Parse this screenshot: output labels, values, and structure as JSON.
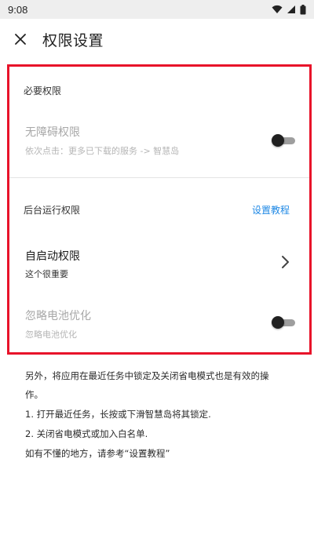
{
  "status_bar": {
    "time": "9:08",
    "icons": [
      "wifi-icon",
      "signal-icon",
      "battery-icon"
    ]
  },
  "app_bar": {
    "close_icon": "close-icon",
    "title": "权限设置"
  },
  "permissions": {
    "required": {
      "section_label": "必要权限",
      "accessibility": {
        "title": "无障碍权限",
        "subtitle": "依次点击：更多已下载的服务 -> 智慧岛",
        "enabled": false
      }
    },
    "background": {
      "section_label": "后台运行权限",
      "tutorial_link": "设置教程",
      "autostart": {
        "title": "自启动权限",
        "subtitle": "这个很重要"
      },
      "battery_optimization": {
        "title": "忽略电池优化",
        "subtitle": "忽略电池优化",
        "enabled": false
      }
    }
  },
  "notes": [
    "另外，将应用在最近任务中锁定及关闭省电模式也是有效的操",
    "作。",
    "1. 打开最近任务，长按或下滑智慧岛将其锁定.",
    "2. 关闭省电模式或加入白名单.",
    "如有不懂的地方，请参考“设置教程”"
  ],
  "colors": {
    "highlight_border": "#e8132a",
    "link": "#1e88e5",
    "toggle_thumb": "#202020",
    "toggle_track": "#9e9e9e"
  }
}
